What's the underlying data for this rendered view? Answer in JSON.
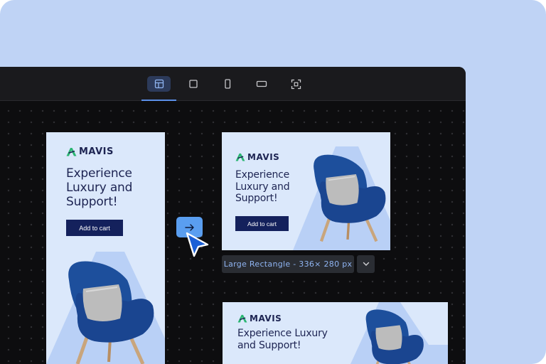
{
  "toolbar": {
    "buttons": [
      {
        "icon": "layout-grid-icon",
        "active": true
      },
      {
        "icon": "square-icon",
        "active": false
      },
      {
        "icon": "portrait-icon",
        "active": false
      },
      {
        "icon": "landscape-icon",
        "active": false
      },
      {
        "icon": "focus-frame-icon",
        "active": false
      }
    ]
  },
  "ads": {
    "skyscraper": {
      "brand": "MAVIS",
      "headline": [
        "Experience",
        "Luxury and",
        "Support!"
      ],
      "cta": "Add to cart"
    },
    "rectangle": {
      "brand": "MAVIS",
      "headline": [
        "Experience",
        "Luxury and",
        "Support!"
      ],
      "cta": "Add to cart"
    },
    "banner": {
      "brand": "MAVIS",
      "headline": [
        "Experience Luxury",
        "and Support!"
      ]
    }
  },
  "size_chip": {
    "label": "Large Rectangle - 336× 280 px"
  },
  "colors": {
    "accent": "#5a9ef0",
    "navy": "#14215c",
    "brand_green": "#2bb673",
    "chair_blue": "#1d4f9c",
    "ad_bg": "#dbe8fb"
  }
}
